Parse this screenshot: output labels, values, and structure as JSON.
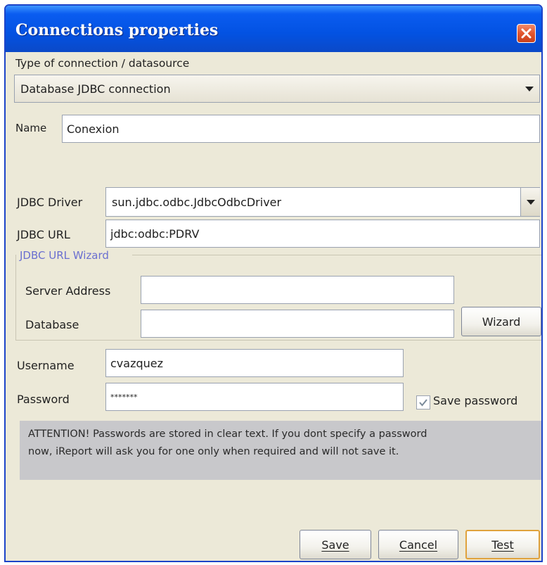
{
  "window": {
    "title": "Connections properties"
  },
  "connection_type": {
    "label": "Type of connection / datasource",
    "selected": "Database JDBC connection"
  },
  "name": {
    "label": "Name",
    "value": "Conexion"
  },
  "jdbc_driver": {
    "label": "JDBC Driver",
    "selected": "sun.jdbc.odbc.JdbcOdbcDriver"
  },
  "jdbc_url": {
    "label": "JDBC URL",
    "value": "jdbc:odbc:PDRV"
  },
  "url_wizard": {
    "group_label": "JDBC URL Wizard",
    "server_address_label": "Server Address",
    "server_address_value": "",
    "database_label": "Database",
    "database_value": "",
    "wizard_button": "Wizard"
  },
  "credentials": {
    "username_label": "Username",
    "username_value": "cvazquez",
    "password_label": "Password",
    "password_value": "*******",
    "save_password_label": "Save password",
    "save_password_checked": true
  },
  "attention": {
    "line1": "ATTENTION! Passwords are stored in clear text. If you dont specify a password",
    "line2": "now, iReport will ask you for one only when required and will not save it."
  },
  "buttons": {
    "save": "Save",
    "cancel": "Cancel",
    "test": "Test"
  },
  "colors": {
    "title_bar": "#0352e2",
    "dialog_bg": "#ece9d8",
    "close_button": "#e2562e",
    "wizard_group_label": "#6a6fd0"
  }
}
